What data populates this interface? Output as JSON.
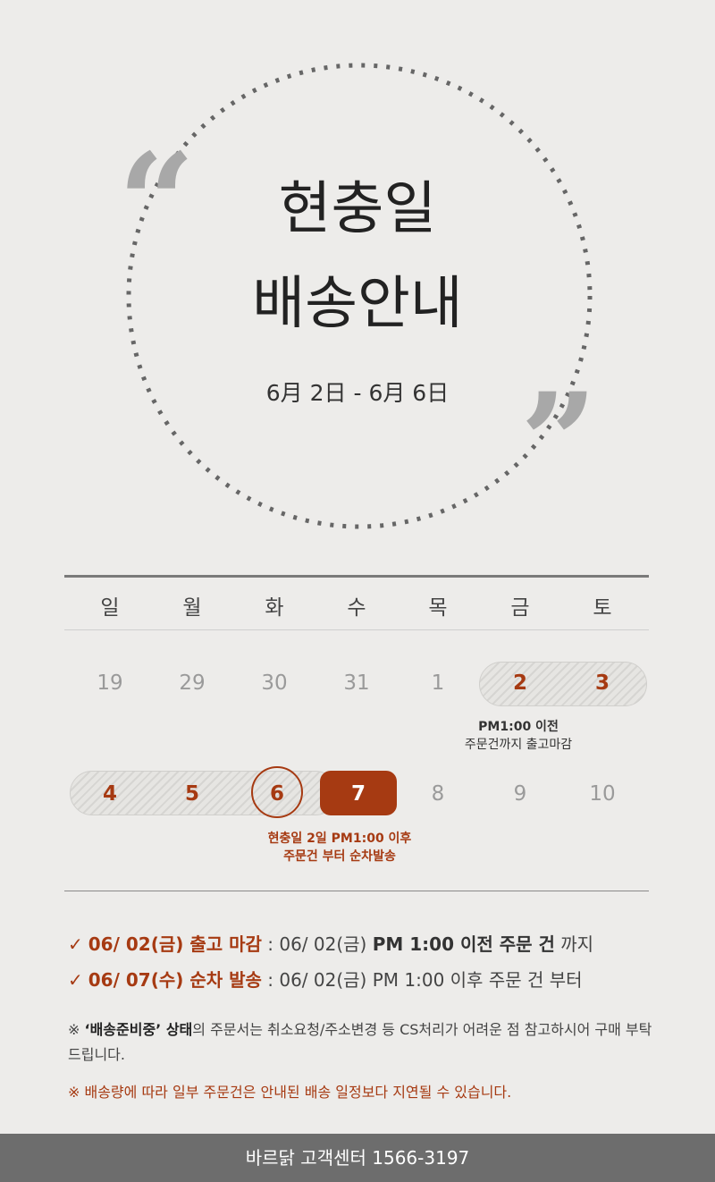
{
  "hero": {
    "quote_open": "“",
    "quote_close": "”",
    "title_line1": "현충일",
    "title_line2": "배송안내",
    "date_range": "6月 2日 - 6月 6日"
  },
  "calendar": {
    "weekdays": [
      "일",
      "월",
      "화",
      "수",
      "목",
      "금",
      "토"
    ],
    "row1": [
      "19",
      "29",
      "30",
      "31",
      "1",
      "2",
      "3"
    ],
    "row2": [
      "4",
      "5",
      "6",
      "7",
      "8",
      "9",
      "10"
    ],
    "note1_line1": "PM1:00 이전",
    "note1_line2": "주문건까지 출고마감",
    "note2_line1": "현충일   2일 PM1:00 이후",
    "note2_line2": "주문건 부터 순차발송"
  },
  "info": {
    "line1_head": "06/ 02(금) 출고 마감",
    "line1_sep": " : ",
    "line1_pre": "06/ 02(금) ",
    "line1_bold": "PM 1:00 이전 주문 건",
    "line1_tail": " 까지",
    "line2_head": "06/ 07(수) 순차 발송",
    "line2_sep": " : ",
    "line2_rest": "06/ 02(금) PM 1:00 이후 주문 건 부터",
    "check": "✓"
  },
  "notice": {
    "n1_mark": "※ ",
    "n1_bold": "‘배송준비중’ 상태",
    "n1_rest": "의 주문서는 취소요청/주소변경 등 CS처리가 어려운 점 참고하시어 구매 부탁드립니다.",
    "n2": "※ 배송량에 따라 일부 주문건은 안내된 배송 일정보다 지연될 수 있습니다."
  },
  "footer": {
    "text": "바르닭 고객센터   1566-3197"
  },
  "colors": {
    "accent": "#a63a12",
    "background": "#edecea",
    "footer_bg": "#6d6d6d"
  }
}
